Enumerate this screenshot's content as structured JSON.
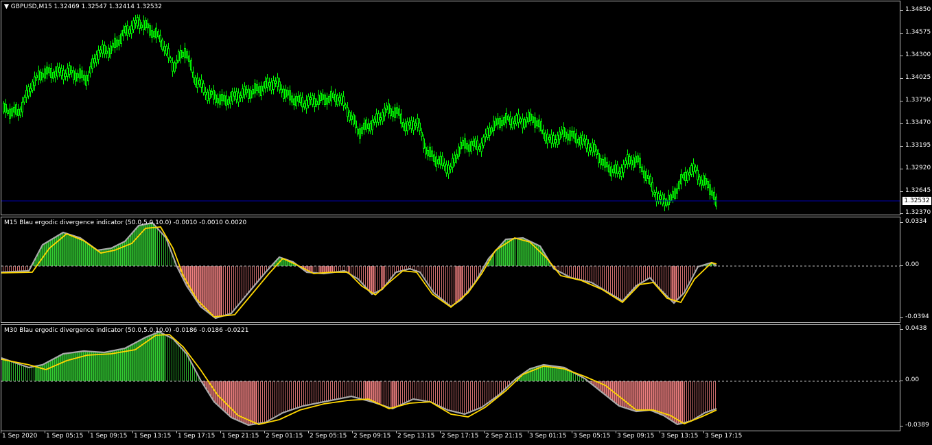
{
  "main": {
    "title": "GBPUSD,M15  1.32469 1.32547 1.32414 1.32532",
    "price_ticks": [
      "1.34850",
      "1.34575",
      "1.34300",
      "1.34025",
      "1.33750",
      "1.33470",
      "1.33195",
      "1.32920",
      "1.32645",
      "1.32370"
    ],
    "current_price": "1.32532",
    "bull_color": "#00ff00",
    "line_color": "#0000b0"
  },
  "ind1": {
    "title": "M15 Blau ergodic divergence indicator (50.0,5.0,10.0) -0.0010 -0.0010 0.0020",
    "ticks": [
      "0.0334",
      "0.00",
      "-0.0394"
    ]
  },
  "ind2": {
    "title": "M30 Blau ergodic divergence indicator (50.0,5.0,10.0) -0.0186 -0.0186 -0.0221",
    "ticks": [
      "0.0438",
      "0.00",
      "-0.0389"
    ]
  },
  "colors": {
    "positive": "#32cd32",
    "negative": "#f08080",
    "signal": "#ffd700",
    "main_line": "#a9a9a9"
  },
  "time_axis": [
    "1 Sep 2020",
    "1 Sep 05:15",
    "1 Sep 09:15",
    "1 Sep 13:15",
    "1 Sep 17:15",
    "1 Sep 21:15",
    "2 Sep 01:15",
    "2 Sep 05:15",
    "2 Sep 09:15",
    "2 Sep 13:15",
    "2 Sep 17:15",
    "2 Sep 21:15",
    "3 Sep 01:15",
    "3 Sep 05:15",
    "3 Sep 09:15",
    "3 Sep 13:15",
    "3 Sep 17:15"
  ]
}
